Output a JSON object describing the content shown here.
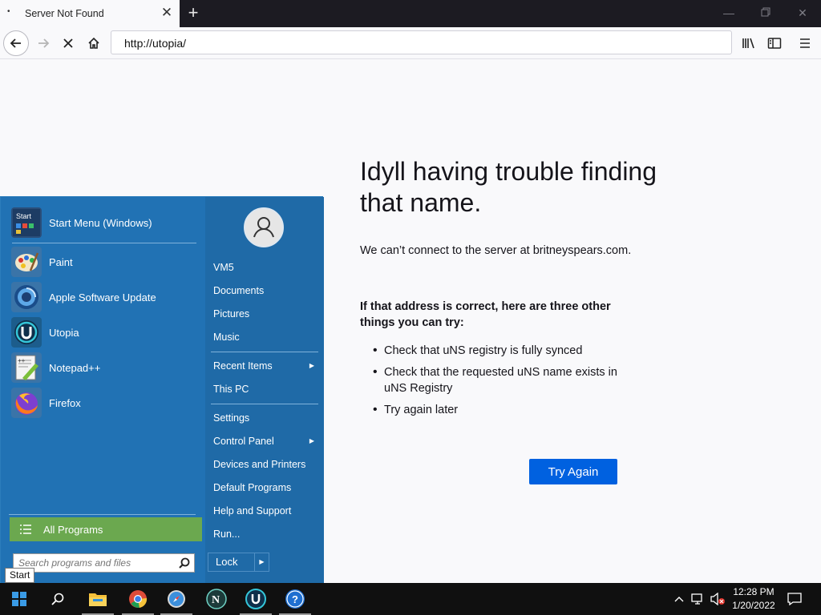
{
  "browser": {
    "tab_title": "Server Not Found",
    "url": "http://utopia/"
  },
  "error_page": {
    "title": "Idyll having trouble finding that name.",
    "message": "We can’t connect to the server at britneyspears.com.",
    "suggestion_heading": "If that address is correct, here are three other things you can try:",
    "suggestions": [
      "Check that uNS registry is fully synced",
      "Check that the requested uNS name exists in uNS Registry",
      "Try again later"
    ],
    "try_again_label": "Try Again"
  },
  "start_menu": {
    "pinned": [
      {
        "label": "Start Menu (Windows)",
        "icon": "start-menu-icon"
      }
    ],
    "programs": [
      {
        "label": "Paint",
        "icon": "paint-icon"
      },
      {
        "label": "Apple Software Update",
        "icon": "apple-software-update-icon"
      },
      {
        "label": "Utopia",
        "icon": "utopia-icon"
      },
      {
        "label": "Notepad++",
        "icon": "notepadpp-icon"
      },
      {
        "label": "Firefox",
        "icon": "firefox-icon"
      }
    ],
    "all_programs_label": "All Programs",
    "search_placeholder": "Search programs and files",
    "right_items": [
      {
        "label": "VM5"
      },
      {
        "label": "Documents"
      },
      {
        "label": "Pictures"
      },
      {
        "label": "Music"
      },
      {
        "label": "Recent Items"
      },
      {
        "label": "This PC"
      },
      {
        "label": "Settings"
      },
      {
        "label": "Control Panel"
      },
      {
        "label": "Devices and Printers"
      },
      {
        "label": "Default Programs"
      },
      {
        "label": "Help and Support"
      },
      {
        "label": "Run..."
      }
    ],
    "lock_label": "Lock",
    "start_tooltip": "Start"
  },
  "taskbar": {
    "apps": [
      "start-icon",
      "search-icon",
      "file-explorer-icon",
      "chrome-icon",
      "safari-icon",
      "nexus-icon",
      "utopia-icon",
      "help-icon"
    ],
    "time": "12:28 PM",
    "date": "1/20/2022"
  }
}
